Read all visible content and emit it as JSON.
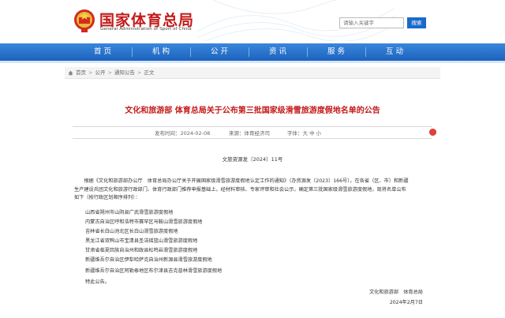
{
  "header": {
    "site_title": "国家体育总局",
    "site_subtitle": "General Administration of Sport of China",
    "search_placeholder": "请输入关键字",
    "search_button": "搜索",
    "brand_color": "#c41a1a",
    "nav_color": "#1c63bd"
  },
  "nav": {
    "items": [
      {
        "label": "首 页"
      },
      {
        "label": "机 构"
      },
      {
        "label": "公 开"
      },
      {
        "label": "资 讯"
      },
      {
        "label": "服 务"
      },
      {
        "label": "互 动"
      }
    ]
  },
  "breadcrumb": {
    "items": [
      "首页",
      "公开",
      "通知公告",
      "正文"
    ],
    "separator": ">"
  },
  "article": {
    "title": "文化和旅游部 体育总局关于公布第三批国家级滑雪旅游度假地名单的公告",
    "publish_time": "发布时间：2024-02-08",
    "source": "来源：体育经济司",
    "font_size": "字体：大 中 小",
    "doc_number": "文旅资源发〔2024〕11号",
    "body_lines": [
      "　　根据《文化和旅游部办公厅　体育总局办公厅关于开展国家级滑雪旅游度假地认定工作的通知》（办资源发〔2023〕166号），在各省（区、市）和新疆",
      "生产建设兵团文化和旅游行政部门、体育行政部门推荐申报基础上，经材料审核、专家评审和社会公示，确定第三批国家级滑雪旅游度假地，现将名单公布",
      "如下（按行政区划顺序排列）："
    ],
    "destinations": [
      "山西省朔州市山阴县广武滑雪旅游度假地",
      "内蒙古自治区呼和浩特市赛罕区马鞍山滑雪旅游度假地",
      "吉林省长白山池北区长白山滑雪旅游度假地",
      "黑龙江省双鸭山市宝清县圣洁摇篮山滑雪旅游度假地",
      "甘肃省临夏回族自治州和政县松鸣岩滑雪旅游度假地",
      "新疆维吾尔自治区伊犁哈萨克自治州新源县滑雪旅游度假地",
      "新疆维吾尔自治区阿勒泰地区布尔津县吉克普林滑雪旅游度假地",
      "特此公告。"
    ],
    "signatories": "文化和旅游部　体育总局",
    "sign_date": "2024年2月7日"
  }
}
